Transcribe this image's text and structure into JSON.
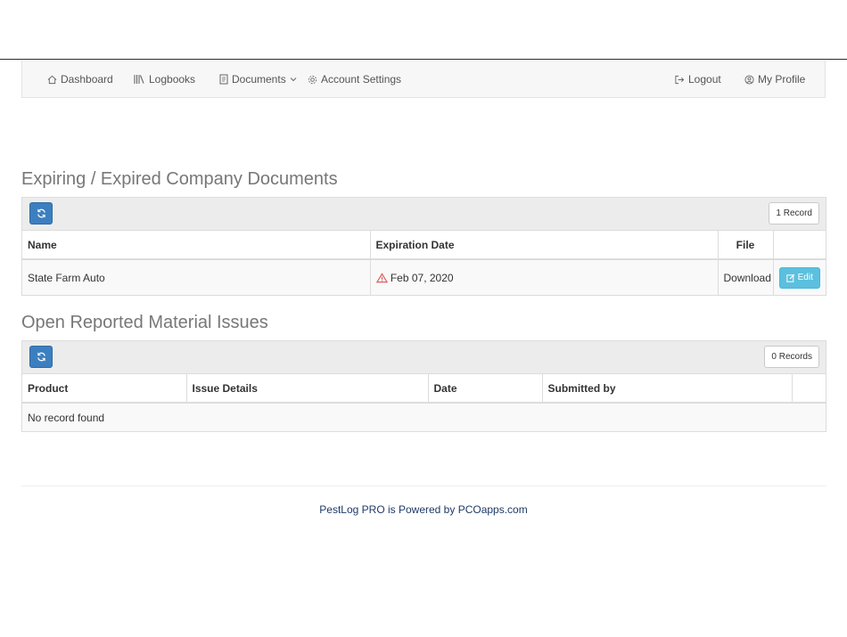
{
  "nav": {
    "dashboard": "Dashboard",
    "logbooks": "Logbooks",
    "documents": "Documents",
    "account_settings": "Account Settings",
    "logout": "Logout",
    "my_profile": "My Profile"
  },
  "expiring": {
    "title": "Expiring / Expired Company Documents",
    "count": "1 Record",
    "columns": [
      "Name",
      "Expiration Date",
      "File",
      ""
    ],
    "rows": [
      {
        "name": "State Farm Auto",
        "expiration": "Feb 07, 2020",
        "file": "Download",
        "action": "Edit"
      }
    ]
  },
  "issues": {
    "title": "Open Reported Material Issues",
    "count": "0 Records",
    "columns": [
      "Product",
      "Issue Details",
      "Date",
      "Submitted by",
      ""
    ],
    "empty_message": "No record found"
  },
  "footer": {
    "text": "PestLog PRO is Powered by PCOapps.com"
  },
  "colors": {
    "primary": "#3c7fc0",
    "info": "#5bc0de",
    "warning": "#d9534f",
    "footer_link": "#1f3a66"
  }
}
